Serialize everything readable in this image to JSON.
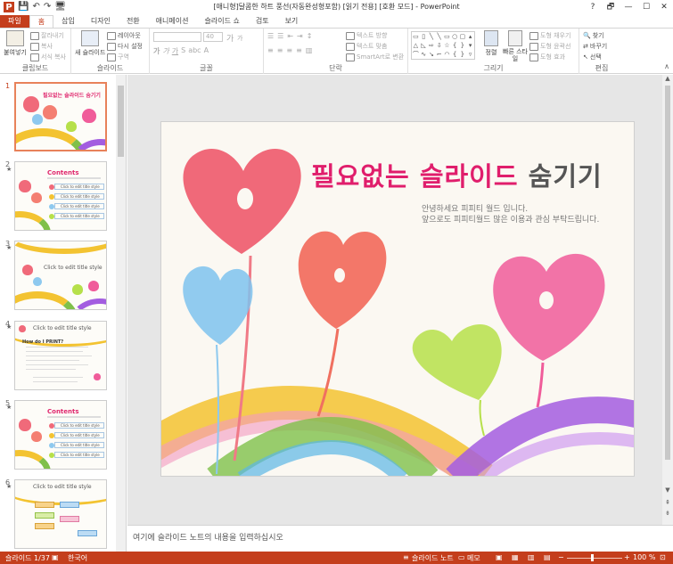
{
  "window": {
    "title": "[애니형]달콤한 하트 풍선(자동완성형포함) [읽기 전용] [호환 모드] - PowerPoint",
    "controls": [
      "?",
      "🗗",
      "—",
      "☐",
      "✕"
    ]
  },
  "qat": {
    "app_letter": "P",
    "save": "💾",
    "undo": "↶",
    "redo": "↷",
    "start": "🖥"
  },
  "tabs": [
    "파일",
    "홈",
    "삽입",
    "디자인",
    "전환",
    "애니메이션",
    "슬라이드 쇼",
    "검토",
    "보기"
  ],
  "ribbon": {
    "clipboard": {
      "label": "클립보드",
      "paste": "붙여넣기",
      "cut": "잘라내기",
      "copy": "복사",
      "format_painter": "서식 복사"
    },
    "slides": {
      "label": "슬라이드",
      "new_slide": "새 슬라이드",
      "layout": "레이아웃",
      "reset": "다시 설정",
      "section": "구역"
    },
    "font": {
      "label": "글꼴",
      "size": "40",
      "grow": "가",
      "shrink": "가"
    },
    "paragraph": {
      "label": "단락",
      "text_direction": "텍스트 방향",
      "align_text": "텍스트 맞춤",
      "smartart": "SmartArt로 변환"
    },
    "drawing": {
      "label": "그리기",
      "arrange": "정렬",
      "quick_styles": "빠른 스타일",
      "shape_fill": "도형 채우기",
      "shape_outline": "도형 윤곽선",
      "shape_effects": "도형 효과"
    },
    "editing": {
      "label": "편집",
      "find": "찾기",
      "replace": "바꾸기",
      "select": "선택"
    }
  },
  "thumbnails": {
    "items": [
      {
        "number": "1",
        "title": "필요없는 슬라이드 숨기기"
      },
      {
        "number": "2",
        "title": "Contents",
        "items": [
          "Click to edit title style",
          "Click to edit title style",
          "Click to edit title style",
          "Click to edit title style"
        ]
      },
      {
        "number": "3",
        "title": "Click to edit title style"
      },
      {
        "number": "4",
        "title": "Click to edit title style",
        "body_title": "How do I PRINT?"
      },
      {
        "number": "5",
        "title": "Contents",
        "items": [
          "Click to edit title style",
          "Click to edit title style",
          "Click to edit title style",
          "Click to edit title style"
        ]
      },
      {
        "number": "6",
        "title": "Click to edit title style"
      }
    ],
    "star": "★"
  },
  "slide": {
    "title_main": "필요없는 슬라이드",
    "title_tail": " 숨기기",
    "subtitle_1": "안녕하세요 피피티 월드 입니다.",
    "subtitle_2": "앞으로도 피피티월드 많은 이용과 관심 부탁드립니다."
  },
  "notes": {
    "placeholder": "여기에 슬라이드 노트의 내용을 입력하십시오"
  },
  "status": {
    "slide_counter": "슬라이드 1/37",
    "language": "한국어",
    "notes": "슬라이드 노트",
    "comments": "메모",
    "zoom": "100 %",
    "zoom_level": 0.45
  },
  "colors": {
    "accent": "#c43e1c",
    "title_pink": "#e01e6c"
  }
}
